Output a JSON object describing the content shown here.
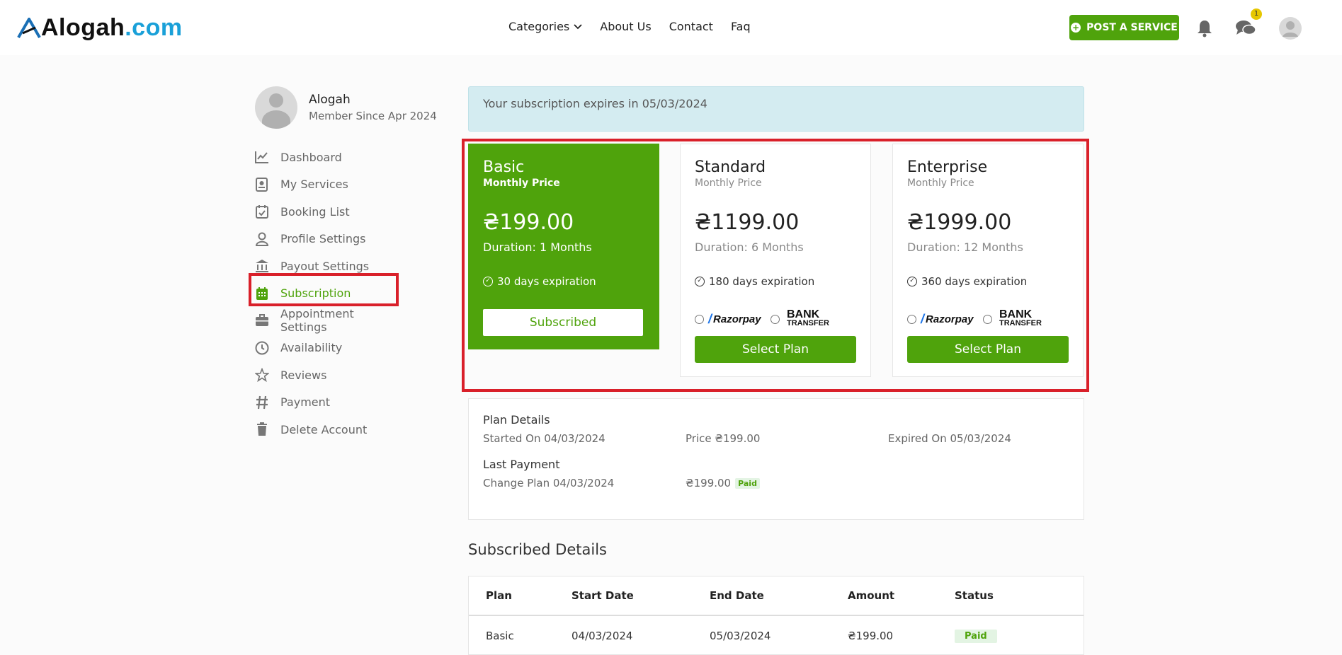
{
  "header": {
    "logo_main": "Alogah",
    "logo_tld": ".com",
    "nav": [
      "Categories",
      "About Us",
      "Contact",
      "Faq"
    ],
    "post_button": "POST A SERVICE",
    "chat_badge": "1"
  },
  "profile": {
    "name": "Alogah",
    "member_since": "Member Since Apr 2024"
  },
  "sidebar": {
    "items": [
      {
        "label": "Dashboard",
        "icon": "chart-icon"
      },
      {
        "label": "My Services",
        "icon": "services-icon"
      },
      {
        "label": "Booking List",
        "icon": "calendar-check-icon"
      },
      {
        "label": "Profile Settings",
        "icon": "user-icon"
      },
      {
        "label": "Payout Settings",
        "icon": "bank-icon"
      },
      {
        "label": "Subscription",
        "icon": "calendar-icon",
        "active": true
      },
      {
        "label": "Appointment Settings",
        "icon": "briefcase-icon"
      },
      {
        "label": "Availability",
        "icon": "clock-icon"
      },
      {
        "label": "Reviews",
        "icon": "star-icon"
      },
      {
        "label": "Payment",
        "icon": "hash-icon"
      },
      {
        "label": "Delete Account",
        "icon": "trash-icon"
      }
    ]
  },
  "alert": "Your subscription expires in 05/03/2024",
  "plans": [
    {
      "name": "Basic",
      "sub": "Monthly Price",
      "price": "₴199.00",
      "duration": "Duration: 1 Months",
      "expiration": "30 days expiration",
      "button": "Subscribed"
    },
    {
      "name": "Standard",
      "sub": "Monthly Price",
      "price": "₴1199.00",
      "duration": "Duration: 6 Months",
      "expiration": "180 days expiration",
      "button": "Select Plan"
    },
    {
      "name": "Enterprise",
      "sub": "Monthly Price",
      "price": "₴1999.00",
      "duration": "Duration: 12 Months",
      "expiration": "360 days expiration",
      "button": "Select Plan"
    }
  ],
  "payment_methods": {
    "razorpay": "Razorpay",
    "bank_top": "BANK",
    "bank_bottom": "TRANSFER"
  },
  "plan_details": {
    "title": "Plan Details",
    "started": "Started On 04/03/2024",
    "price": "Price ₴199.00",
    "expired": "Expired On 05/03/2024"
  },
  "last_payment": {
    "title": "Last Payment",
    "change": "Change Plan 04/03/2024",
    "amount": "₴199.00",
    "status": "Paid"
  },
  "subscribed_details": {
    "title": "Subscribed Details",
    "columns": [
      "Plan",
      "Start Date",
      "End Date",
      "Amount",
      "Status"
    ],
    "rows": [
      {
        "plan": "Basic",
        "start": "04/03/2024",
        "end": "05/03/2024",
        "amount": "₴199.00",
        "status": "Paid"
      }
    ]
  },
  "colors": {
    "brand_green": "#4fa30c",
    "highlight_red": "#d9202a",
    "alert_bg": "#d4ecf1",
    "logo_blue": "#1aa0d8"
  }
}
